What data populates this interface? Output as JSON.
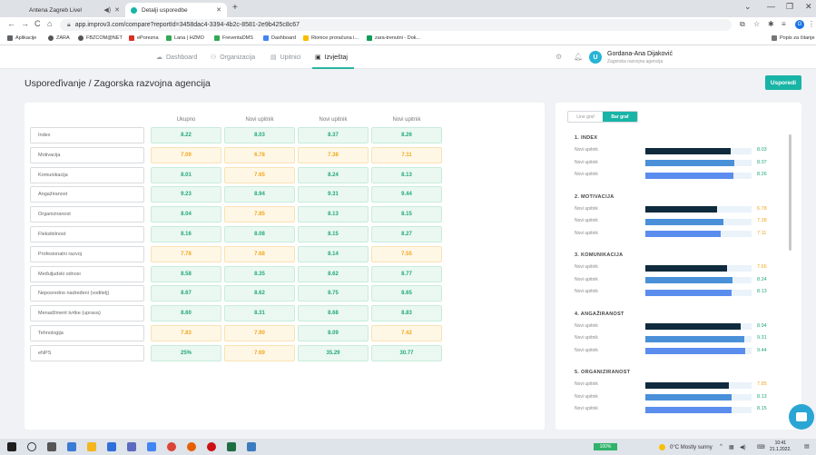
{
  "browser": {
    "tabs": [
      {
        "title": "Antena Zagreb Live!",
        "active": false
      },
      {
        "title": "Detalji usporedbe",
        "active": true
      }
    ],
    "url": "app.improv3.com/compare?reportId=3458dac4-3394-4b2c-8581-2e9b425c8c67",
    "bookmarks": [
      "Aplikacije",
      "ZARA",
      "FBZCOM@NET",
      "ePorezna",
      "Lana | HZMO",
      "FreventaDMS",
      "Dashboard",
      "Rionice proračuna i...",
      "zara-trenutni - Dok..."
    ],
    "reading_list": "Popis za čitanje",
    "profile_initial": "G"
  },
  "header": {
    "nav": [
      {
        "label": "Dashboard",
        "icon": "cloud-icon"
      },
      {
        "label": "Organizacija",
        "icon": "org-chart-icon"
      },
      {
        "label": "Upitnici",
        "icon": "document-icon"
      },
      {
        "label": "Izvještaj",
        "icon": "report-icon",
        "active": true
      }
    ],
    "user": {
      "initial": "U",
      "name": "Gordana-Ana Dijaković",
      "org": "Zagorska razvojna agencija"
    }
  },
  "page": {
    "title": "Usporeďivanje / Zagorska razvojna agencija",
    "compare_button": "Usporedi"
  },
  "table": {
    "columns": [
      "Ukupno",
      "Novi upitnik",
      "Novi upitnik",
      "Novi upitnik"
    ],
    "rows": [
      {
        "label": "Index",
        "values": [
          "8.22",
          "8.03",
          "8.37",
          "8.26"
        ],
        "status": [
          "good",
          "good",
          "good",
          "good"
        ]
      },
      {
        "label": "Motivacija",
        "values": [
          "7.09",
          "6.78",
          "7.38",
          "7.11"
        ],
        "status": [
          "warn",
          "warn",
          "warn",
          "warn"
        ]
      },
      {
        "label": "Komunikacija",
        "values": [
          "8.01",
          "7.65",
          "8.24",
          "8.13"
        ],
        "status": [
          "good",
          "warn",
          "good",
          "good"
        ]
      },
      {
        "label": "Angažiranost",
        "values": [
          "9.23",
          "8.94",
          "9.31",
          "9.44"
        ],
        "status": [
          "good",
          "good",
          "good",
          "good"
        ]
      },
      {
        "label": "Organiziranost",
        "values": [
          "8.04",
          "7.85",
          "8.13",
          "8.15"
        ],
        "status": [
          "good",
          "warn",
          "good",
          "good"
        ]
      },
      {
        "label": "Fleksibilnost",
        "values": [
          "8.16",
          "8.08",
          "8.15",
          "8.27"
        ],
        "status": [
          "good",
          "good",
          "good",
          "good"
        ]
      },
      {
        "label": "Profesionalni razvoj",
        "values": [
          "7.78",
          "7.68",
          "8.14",
          "7.55"
        ],
        "status": [
          "warn",
          "warn",
          "good",
          "warn"
        ]
      },
      {
        "label": "Međuljudski odnosi",
        "values": [
          "8.58",
          "8.35",
          "8.62",
          "8.77"
        ],
        "status": [
          "good",
          "good",
          "good",
          "good"
        ]
      },
      {
        "label": "Neposredno nadređeni (voditelj)",
        "values": [
          "8.67",
          "8.62",
          "8.75",
          "8.65"
        ],
        "status": [
          "good",
          "good",
          "good",
          "good"
        ]
      },
      {
        "label": "Menadžment tvrtke (uprava)",
        "values": [
          "8.60",
          "8.31",
          "8.68",
          "8.83"
        ],
        "status": [
          "good",
          "good",
          "good",
          "good"
        ]
      },
      {
        "label": "Tehnologija",
        "values": [
          "7.83",
          "7.90",
          "8.09",
          "7.42"
        ],
        "status": [
          "warn",
          "warn",
          "good",
          "warn"
        ]
      },
      {
        "label": "eNPS",
        "values": [
          "25%",
          "7.69",
          "35.29",
          "30.77"
        ],
        "status": [
          "good",
          "warn",
          "good",
          "good"
        ]
      }
    ]
  },
  "bar_panel": {
    "toggle": {
      "line": "Line graf",
      "bar": "Bar graf",
      "active": "bar"
    },
    "colors": [
      "#0f2b3d",
      "#4a90d9",
      "#5b8def"
    ],
    "warn_color": "#f0a81e",
    "good_color": "#23a87a",
    "sections": [
      {
        "title": "1. INDEX",
        "bars": [
          {
            "label": "Novi upitnik",
            "value": "8.03",
            "status": "good"
          },
          {
            "label": "Novi upitnik",
            "value": "8.37",
            "status": "good"
          },
          {
            "label": "Novi upitnik",
            "value": "8.26",
            "status": "good"
          }
        ]
      },
      {
        "title": "2. MOTIVACIJA",
        "bars": [
          {
            "label": "Novi upitnik",
            "value": "6.78",
            "status": "warn"
          },
          {
            "label": "Novi upitnik",
            "value": "7.38",
            "status": "warn"
          },
          {
            "label": "Novi upitnik",
            "value": "7.11",
            "status": "warn"
          }
        ]
      },
      {
        "title": "3. KOMUNIKACIJA",
        "bars": [
          {
            "label": "Novi upitnik",
            "value": "7.65",
            "status": "warn"
          },
          {
            "label": "Novi upitnik",
            "value": "8.24",
            "status": "good"
          },
          {
            "label": "Novi upitnik",
            "value": "8.13",
            "status": "good"
          }
        ]
      },
      {
        "title": "4. ANGAŽIRANOST",
        "bars": [
          {
            "label": "Novi upitnik",
            "value": "8.94",
            "status": "good"
          },
          {
            "label": "Novi upitnik",
            "value": "9.31",
            "status": "good"
          },
          {
            "label": "Novi upitnik",
            "value": "9.44",
            "status": "good"
          }
        ]
      },
      {
        "title": "5. ORGANIZIRANOST",
        "bars": [
          {
            "label": "Novi upitnik",
            "value": "7.85",
            "status": "warn"
          },
          {
            "label": "Novi upitnik",
            "value": "8.13",
            "status": "good"
          },
          {
            "label": "Novi upitnik",
            "value": "8.15",
            "status": "good"
          }
        ]
      }
    ]
  },
  "taskbar": {
    "zoom": "100%",
    "weather": "0°C  Mostly sunny",
    "time": "10:41",
    "date": "21.1.2022."
  }
}
